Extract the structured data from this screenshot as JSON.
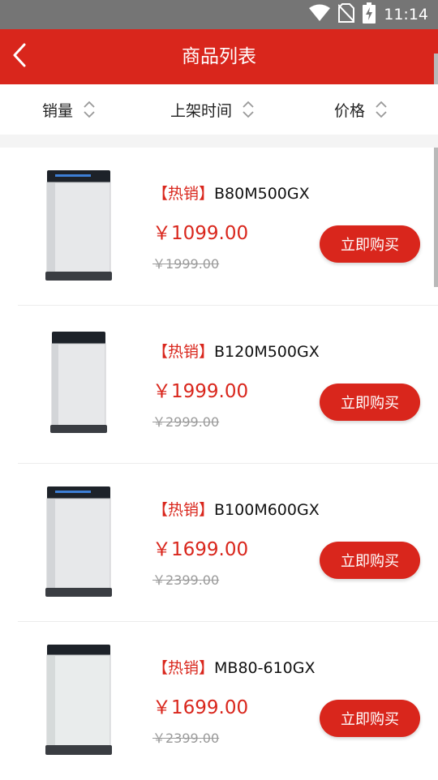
{
  "status_bar": {
    "time": "11:14",
    "icons": [
      "wifi-icon",
      "no-sim-icon",
      "battery-charging-icon"
    ]
  },
  "header": {
    "title": "商品列表",
    "back_icon": "chevron-left-icon"
  },
  "sort_bar": {
    "items": [
      {
        "label": "销量",
        "icon": "sort-updown-icon"
      },
      {
        "label": "上架时间",
        "icon": "sort-updown-icon"
      },
      {
        "label": "价格",
        "icon": "sort-updown-icon"
      }
    ]
  },
  "products": [
    {
      "tag": "【热销】",
      "model": "B80M500GX",
      "price": "￥1099.00",
      "original_price": "￥1999.00",
      "buy_label": "立即购买"
    },
    {
      "tag": "【热销】",
      "model": "B120M500GX",
      "price": "￥1999.00",
      "original_price": "￥2999.00",
      "buy_label": "立即购买"
    },
    {
      "tag": "【热销】",
      "model": "B100M600GX",
      "price": "￥1699.00",
      "original_price": "￥2399.00",
      "buy_label": "立即购买"
    },
    {
      "tag": "【热销】",
      "model": "MB80-610GX",
      "price": "￥1699.00",
      "original_price": "￥2399.00",
      "buy_label": "立即购买"
    }
  ],
  "colors": {
    "primary": "#d9261c",
    "status_bar": "#757575",
    "strike_text": "#9a9a9a"
  }
}
